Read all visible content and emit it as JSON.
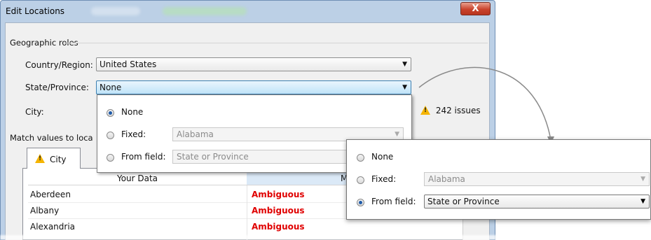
{
  "window": {
    "title": "Edit Locations",
    "title_blur_1": "Rows",
    "title_blur_2": "Latitude (generated)",
    "close_label": "X"
  },
  "group": {
    "label": "Geographic roles"
  },
  "country": {
    "label": "Country/Region:",
    "value": "United States"
  },
  "state": {
    "label": "State/Province:",
    "value": "None"
  },
  "city": {
    "label": "City:",
    "issues": "242 issues"
  },
  "match": {
    "label": "Match values to loca"
  },
  "dropdown": {
    "none_label": "None",
    "fixed_label": "Fixed:",
    "fixed_value": "Alabama",
    "field_label": "From field:",
    "field_value": "State or Province",
    "selected": "None"
  },
  "tab": {
    "label": "City"
  },
  "table": {
    "columns": [
      "Your Data",
      "Matchi"
    ],
    "rows": [
      {
        "data": "Aberdeen",
        "match": "Ambiguous"
      },
      {
        "data": "Albany",
        "match": "Ambiguous"
      },
      {
        "data": "Alexandria",
        "match": "Ambiguous"
      }
    ]
  },
  "callout": {
    "none_label": "None",
    "fixed_label": "Fixed:",
    "fixed_value": "Alabama",
    "field_label": "From field:",
    "field_value": "State or Province",
    "selected": "From field"
  },
  "colors": {
    "accent": "#3c7fb1",
    "ambiguous": "#e00000",
    "warning": "#f5b400"
  }
}
